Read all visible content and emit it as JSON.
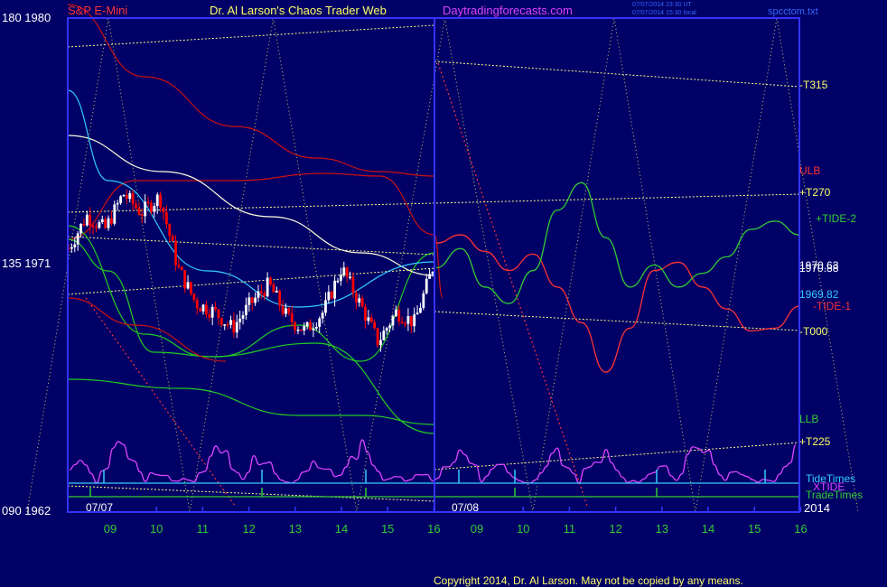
{
  "header": {
    "symbol": "S&P E-Mini",
    "site_title": "Dr. Al Larson's Chaos Trader Web",
    "site_url": "Daytradingforecasts.com",
    "stamp_line1": "07/07/2014 23:30 UT",
    "stamp_line2": "07/07/2014 15:30 local",
    "chart_file": "spcctom.txt"
  },
  "footer": {
    "copyright": "Copyright 2014, Dr. Al Larson. May not be copied by any means."
  },
  "colors": {
    "background": "#000066",
    "price_up": "#ffffff",
    "price_down": "#ff0000",
    "grid": "#ffff66",
    "frame": "#3333ff",
    "tide1": "#ff3333",
    "tide2": "#33cc33",
    "xtide": "#dd44ff",
    "band": "#cc1111",
    "lower_band": "#22cc22",
    "ma_slow": "#ffffdd",
    "ma_fast": "#33ccff",
    "tide_times": "#33ccff",
    "trade_times": "#33cc33",
    "flux": "#ffff88"
  },
  "chart_data": {
    "type": "line",
    "title": "S&P E-Mini",
    "y_left_labels": [
      "180  1980",
      "135  1971",
      "090  1962"
    ],
    "ylim": [
      1962,
      1980
    ],
    "y_right_labels": [
      {
        "text": "-T315",
        "value": 1978.3
      },
      {
        "text": "ULB",
        "value": 1973.2
      },
      {
        "text": "+T270",
        "value": 1972.5
      },
      {
        "text": "+TIDE-2",
        "value": 1972.0
      },
      {
        "text": "1970.88",
        "value": 1970.9
      },
      {
        "text": "1970.63",
        "value": 1970.75
      },
      {
        "text": "1969.82",
        "value": 1969.82
      },
      {
        "text": "-TIDE-1",
        "value": 1969.5
      },
      {
        "text": "-T000",
        "value": 1968.9
      },
      {
        "text": "LLB",
        "value": 1965.7
      },
      {
        "text": "+T225",
        "value": 1964.8
      },
      {
        "text": "TideTimes",
        "value": 1963.9
      },
      {
        "text": "XTIDE",
        "value": 1963.6
      },
      {
        "text": "TradeTimes",
        "value": 1963.3
      }
    ],
    "day_labels": [
      "07/07",
      "07/08"
    ],
    "year_label": "2014",
    "hour_ticks": [
      "09",
      "10",
      "11",
      "12",
      "13",
      "14",
      "15",
      "16",
      "09",
      "10",
      "11",
      "12",
      "13",
      "14",
      "15",
      "16"
    ],
    "series": [
      {
        "name": "-TIDE-1",
        "values": [
          1971.8,
          1972.1,
          1971.5,
          1970.8,
          1971.4,
          1970.2,
          1968.9,
          1967.1,
          1968.7,
          1970.8,
          1971.1,
          1970.2,
          1969.4,
          1968.6,
          1968.7,
          1969.5
        ]
      },
      {
        "name": "+TIDE-2",
        "values": [
          1970.9,
          1971.6,
          1970.2,
          1969.6,
          1970.8,
          1973.0,
          1974.0,
          1972.0,
          1970.2,
          1971.0,
          1970.2,
          1970.7,
          1971.3,
          1972.3,
          1972.6,
          1972.1
        ]
      }
    ],
    "price_path": [
      1971.6,
      1972.8,
      1972.3,
      1973.6,
      1972.9,
      1973.5,
      1970.9,
      1969.6,
      1969.3,
      1968.7,
      1969.6,
      1970.3,
      1969.1,
      1968.6,
      1969.3,
      1970.9,
      1969.6,
      1968.2,
      1969.3,
      1968.9,
      1970.9
    ],
    "last_price": 1970.88
  }
}
